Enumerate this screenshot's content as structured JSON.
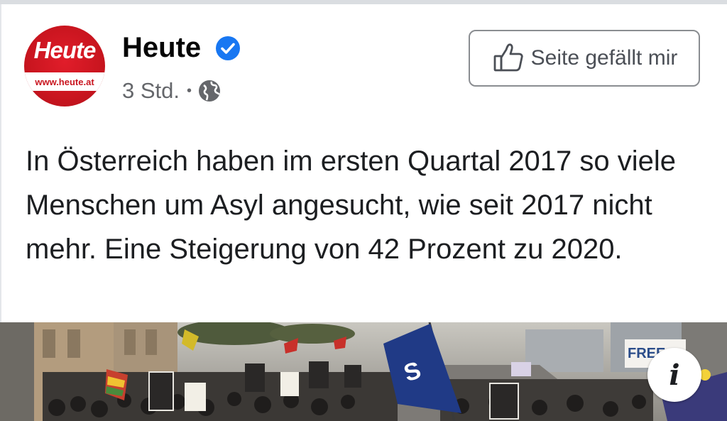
{
  "post": {
    "page_name": "Heute",
    "verified_icon": "verified-badge-icon",
    "time": "3 Std.",
    "separator": "•",
    "audience_icon": "globe-icon",
    "text": "In Österreich haben im ersten Quartal 2017 so viele Menschen um Asyl angesucht, wie seit 2017 nicht mehr. Eine Steigerung von 42 Prozent zu 2020."
  },
  "logo": {
    "word": "Heute",
    "url": "www.heute.at",
    "color": "#c9151f"
  },
  "like_button": {
    "icon": "thumbs-up-icon",
    "label": "Seite gefällt mir"
  },
  "photo": {
    "description_icon": "info-icon",
    "info_label": "i",
    "sign_text": "FREE"
  },
  "colors": {
    "verified": "#1877f2",
    "secondary_text": "#65676b",
    "primary_text": "#1c1e21"
  }
}
